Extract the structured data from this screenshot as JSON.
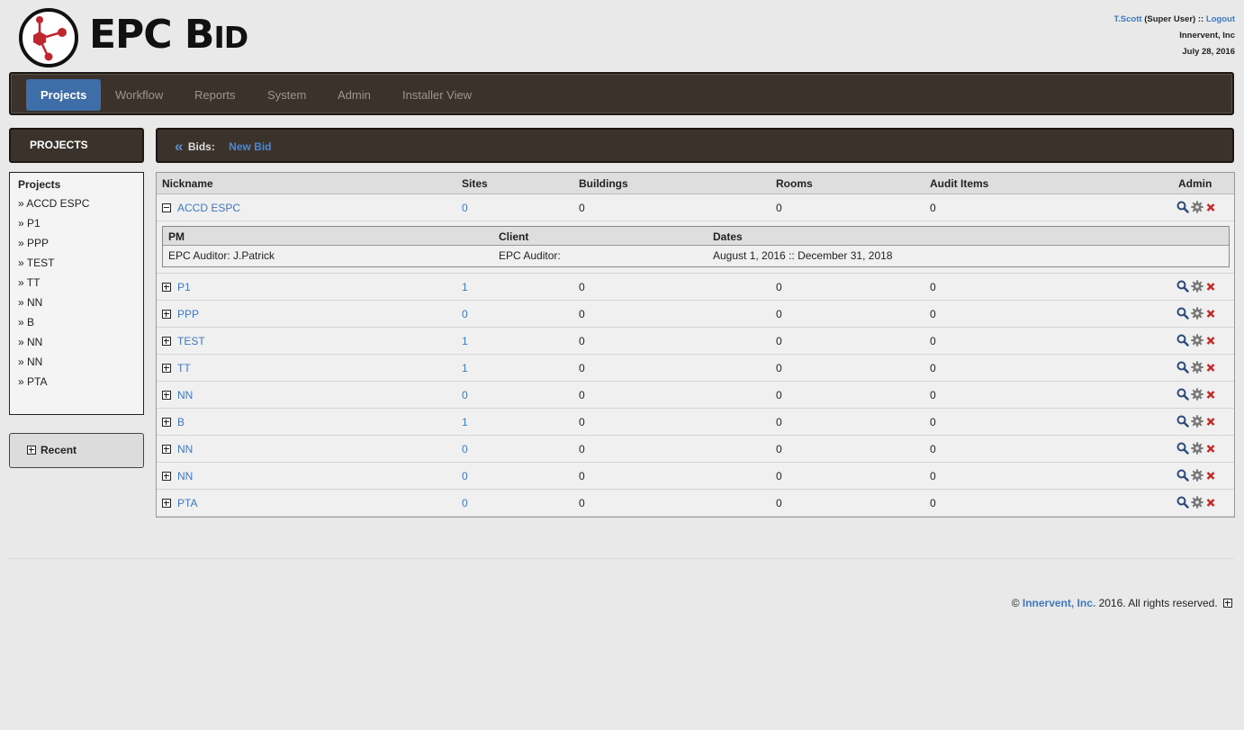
{
  "app": {
    "logo_text_big": "EPC B",
    "logo_text_small": "ID"
  },
  "user": {
    "name": "T.Scott",
    "role": "(Super User)",
    "separator": "::",
    "logout": "Logout",
    "company": "Innervent, Inc",
    "date": "July 28, 2016"
  },
  "nav": {
    "items": [
      {
        "label": "Projects",
        "active": true
      },
      {
        "label": "Workflow"
      },
      {
        "label": "Reports"
      },
      {
        "label": "System"
      },
      {
        "label": "Admin"
      },
      {
        "label": "Installer View"
      }
    ]
  },
  "sidebar": {
    "heading": "PROJECTS",
    "title": "Projects",
    "items": [
      {
        "label": "» ACCD ESPC"
      },
      {
        "label": "» P1"
      },
      {
        "label": "» PPP"
      },
      {
        "label": "» TEST"
      },
      {
        "label": "» TT"
      },
      {
        "label": "» NN"
      },
      {
        "label": "» B"
      },
      {
        "label": "» NN"
      },
      {
        "label": "» NN"
      },
      {
        "label": "» PTA"
      }
    ],
    "recent_label": "Recent"
  },
  "breadcrumb": {
    "chevron": "«",
    "label": "Bids:",
    "link": "New Bid"
  },
  "table": {
    "columns": [
      "Nickname",
      "Sites",
      "Buildings",
      "Rooms",
      "Audit Items",
      "Admin"
    ],
    "rows": [
      {
        "nickname": "ACCD ESPC",
        "sites": "0",
        "buildings": "0",
        "rooms": "0",
        "audit_items": "0",
        "expanded": true
      },
      {
        "nickname": "P1",
        "sites": "1",
        "buildings": "0",
        "rooms": "0",
        "audit_items": "0"
      },
      {
        "nickname": "PPP",
        "sites": "0",
        "buildings": "0",
        "rooms": "0",
        "audit_items": "0"
      },
      {
        "nickname": "TEST",
        "sites": "1",
        "buildings": "0",
        "rooms": "0",
        "audit_items": "0"
      },
      {
        "nickname": "TT",
        "sites": "1",
        "buildings": "0",
        "rooms": "0",
        "audit_items": "0"
      },
      {
        "nickname": "NN",
        "sites": "0",
        "buildings": "0",
        "rooms": "0",
        "audit_items": "0"
      },
      {
        "nickname": "B",
        "sites": "1",
        "buildings": "0",
        "rooms": "0",
        "audit_items": "0"
      },
      {
        "nickname": "NN",
        "sites": "0",
        "buildings": "0",
        "rooms": "0",
        "audit_items": "0"
      },
      {
        "nickname": "NN",
        "sites": "0",
        "buildings": "0",
        "rooms": "0",
        "audit_items": "0"
      },
      {
        "nickname": "PTA",
        "sites": "0",
        "buildings": "0",
        "rooms": "0",
        "audit_items": "0"
      }
    ],
    "detail": {
      "columns": [
        "PM",
        "Client",
        "Dates"
      ],
      "pm": "EPC Auditor:  J.Patrick",
      "client": "EPC Auditor:",
      "dates": "August 1, 2016 :: December 31, 2018"
    }
  },
  "footer": {
    "copyright": "©",
    "brand": "Innervent, Inc.",
    "rest": "2016. All rights reserved."
  },
  "colors": {
    "nav_bg": "#3a322b",
    "accent": "#3d6ea8",
    "link": "#3f78c0",
    "delete": "#c62828"
  }
}
